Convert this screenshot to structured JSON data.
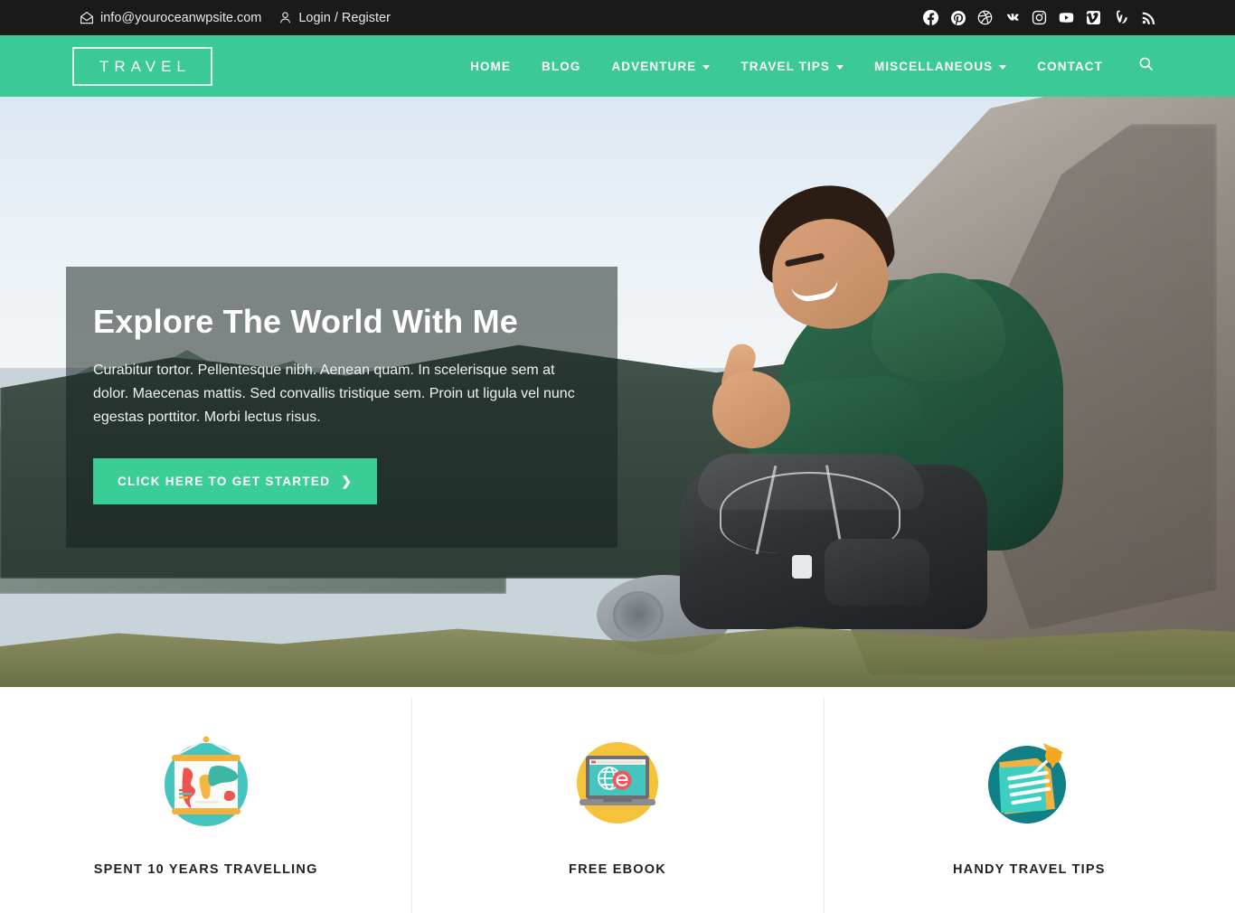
{
  "topbar": {
    "email": "info@youroceanwpsite.com",
    "email_icon": "envelope-home-icon",
    "account_label": "Login / Register",
    "account_icon": "user-icon",
    "social": [
      {
        "name": "facebook-icon",
        "label": "Facebook"
      },
      {
        "name": "pinterest-icon",
        "label": "Pinterest"
      },
      {
        "name": "dribbble-icon",
        "label": "Dribbble"
      },
      {
        "name": "vk-icon",
        "label": "VK"
      },
      {
        "name": "instagram-icon",
        "label": "Instagram"
      },
      {
        "name": "youtube-icon",
        "label": "YouTube"
      },
      {
        "name": "vimeo-square-icon",
        "label": "Vimeo"
      },
      {
        "name": "vine-icon",
        "label": "Vine"
      },
      {
        "name": "rss-icon",
        "label": "RSS"
      }
    ]
  },
  "header": {
    "logo_text": "TRAVEL",
    "nav": [
      {
        "label": "HOME",
        "has_dropdown": false
      },
      {
        "label": "BLOG",
        "has_dropdown": false
      },
      {
        "label": "ADVENTURE",
        "has_dropdown": true
      },
      {
        "label": "TRAVEL TIPS",
        "has_dropdown": true
      },
      {
        "label": "MISCELLANEOUS",
        "has_dropdown": true
      },
      {
        "label": "CONTACT",
        "has_dropdown": false
      }
    ],
    "search_icon": "search-icon"
  },
  "hero": {
    "title": "Explore The World With Me",
    "description": "Curabitur tortor. Pellentesque nibh. Aenean quam. In scelerisque sem at dolor. Maecenas mattis. Sed convallis tristique sem. Proin ut ligula vel nunc egestas porttitor. Morbi lectus risus.",
    "cta_label": "CLICK HERE TO GET STARTED",
    "cta_chevron": "chevron-right-icon"
  },
  "features": [
    {
      "title": "SPENT 10 YEARS TRAVELLING",
      "icon": "world-map-poster-icon"
    },
    {
      "title": "FREE EBOOK",
      "icon": "laptop-ebook-icon"
    },
    {
      "title": "HANDY TRAVEL TIPS",
      "icon": "pinned-note-icon"
    }
  ],
  "colors": {
    "brand_green": "#3bc995",
    "cta_green": "#3bcd96",
    "topbar_bg": "#1a1a1a",
    "heading_dark": "#1b2327",
    "teal": "#3fc4b7",
    "yellow": "#f5c33b",
    "deep_teal": "#117f86"
  }
}
